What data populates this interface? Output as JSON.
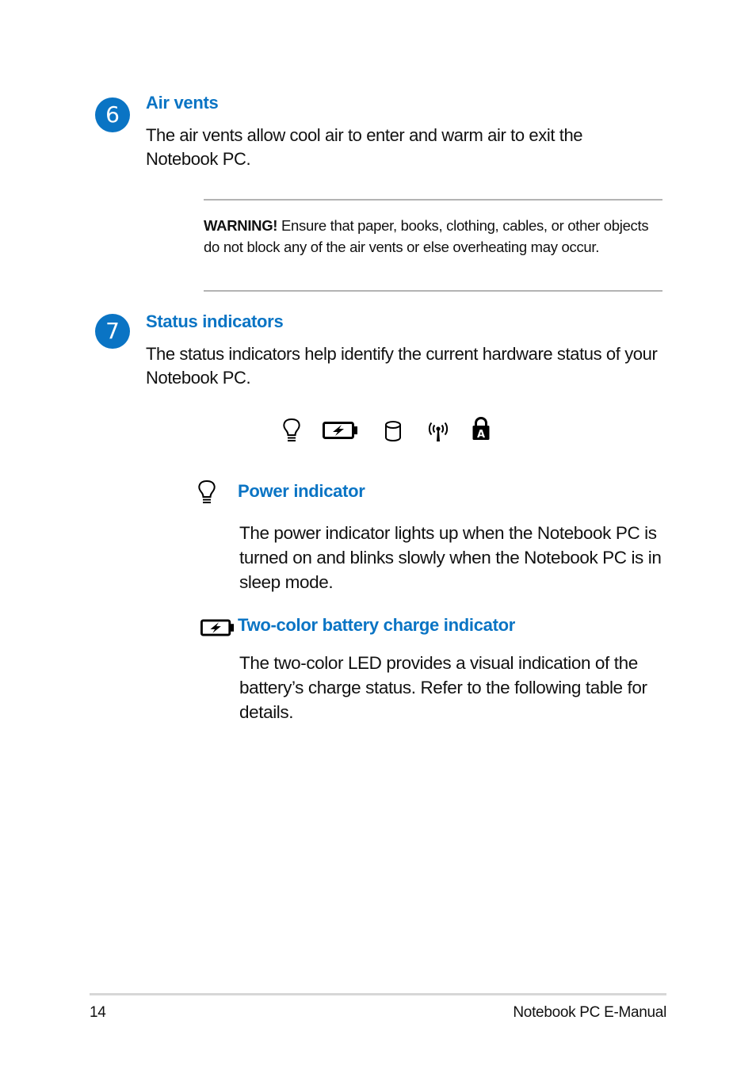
{
  "sections": [
    {
      "number": "6",
      "title": "Air vents",
      "body": "The air vents allow cool air to enter and warm air to exit the Notebook PC.",
      "warning": {
        "label": "WARNING!",
        "text": " Ensure that paper, books, clothing, cables, or other objects do not block any of the air vents or else overheating may occur."
      }
    },
    {
      "number": "7",
      "title": "Status indicators",
      "body": "The status indicators help identify the current hardware status of your Notebook PC.",
      "icons": [
        "power-bulb-icon",
        "battery-charge-icon",
        "storage-drive-icon",
        "wireless-antenna-icon",
        "caps-lock-icon"
      ],
      "caps_lock_letter": "A",
      "subsections": [
        {
          "icon": "power-bulb-icon",
          "title": "Power indicator",
          "body": "The power indicator lights up when the Notebook PC is turned on and blinks slowly when the Notebook PC is in sleep mode."
        },
        {
          "icon": "battery-charge-icon",
          "title": "Two-color battery charge indicator",
          "body": "The two-color LED provides a visual indication of the battery’s charge status. Refer to the following table for details."
        }
      ]
    }
  ],
  "footer": {
    "page_number": "14",
    "manual_title": "Notebook PC E-Manual"
  },
  "colors": {
    "accent": "#0a74c4",
    "text": "#111111",
    "rule": "#b3b3b3"
  }
}
